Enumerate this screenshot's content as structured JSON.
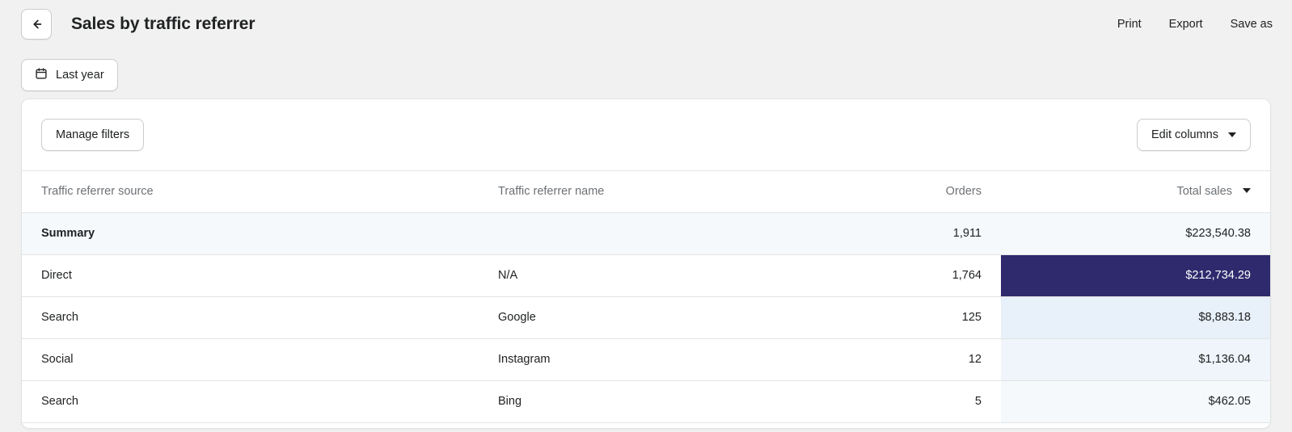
{
  "header": {
    "back_icon": "arrow-left-icon",
    "title": "Sales by traffic referrer",
    "actions": [
      {
        "label": "Print"
      },
      {
        "label": "Export"
      },
      {
        "label": "Save as"
      }
    ]
  },
  "filters": {
    "date_range": {
      "icon": "calendar-icon",
      "label": "Last year"
    }
  },
  "card": {
    "toolbar": {
      "manage_filters_label": "Manage filters",
      "edit_columns_label": "Edit columns",
      "edit_columns_caret_icon": "chevron-down-icon"
    },
    "table": {
      "columns": [
        {
          "key": "source",
          "label": "Traffic referrer source",
          "align": "left"
        },
        {
          "key": "name",
          "label": "Traffic referrer name",
          "align": "left"
        },
        {
          "key": "orders",
          "label": "Orders",
          "align": "right"
        },
        {
          "key": "sales",
          "label": "Total sales",
          "align": "right",
          "sorted": "desc",
          "sort_icon": "caret-down-icon"
        }
      ],
      "summary": {
        "label": "Summary",
        "name": "",
        "orders": "1,911",
        "sales": "$223,540.38"
      },
      "rows": [
        {
          "source": "Direct",
          "name": "N/A",
          "orders": "1,764",
          "sales": "$212,734.29",
          "bar_pct": 100,
          "bar_style": "dark"
        },
        {
          "source": "Search",
          "name": "Google",
          "orders": "125",
          "sales": "$8,883.18",
          "bar_pct": 100,
          "bar_style": "tint-strong"
        },
        {
          "source": "Social",
          "name": "Instagram",
          "orders": "12",
          "sales": "$1,136.04",
          "bar_pct": 100,
          "bar_style": "tint-mid"
        },
        {
          "source": "Search",
          "name": "Bing",
          "orders": "5",
          "sales": "$462.05",
          "bar_pct": 100,
          "bar_style": "tint-faint"
        }
      ]
    }
  },
  "colors": {
    "page_background": "#f1f1f1",
    "card_background": "#ffffff",
    "border": "#e3e3e3",
    "text_primary": "#202223",
    "text_secondary": "#6d7175",
    "bar_dark": "#2f2a6d",
    "bar_tint_strong": "#e8f0f9",
    "bar_tint_mid": "#eff5fb",
    "bar_tint_faint": "#f5f9fc",
    "summary_row_background": "#f6f9fc"
  },
  "chart_data": {
    "type": "table",
    "title": "Sales by traffic referrer",
    "date_range": "Last year",
    "columns": [
      "Traffic referrer source",
      "Traffic referrer name",
      "Orders",
      "Total sales"
    ],
    "sort": {
      "column": "Total sales",
      "direction": "desc"
    },
    "summary": {
      "orders": 1911,
      "total_sales": 223540.38
    },
    "rows": [
      {
        "source": "Direct",
        "name": "N/A",
        "orders": 1764,
        "total_sales": 212734.29
      },
      {
        "source": "Search",
        "name": "Google",
        "orders": 125,
        "total_sales": 8883.18
      },
      {
        "source": "Social",
        "name": "Instagram",
        "orders": 12,
        "total_sales": 1136.04
      },
      {
        "source": "Search",
        "name": "Bing",
        "orders": 5,
        "total_sales": 462.05
      }
    ]
  }
}
